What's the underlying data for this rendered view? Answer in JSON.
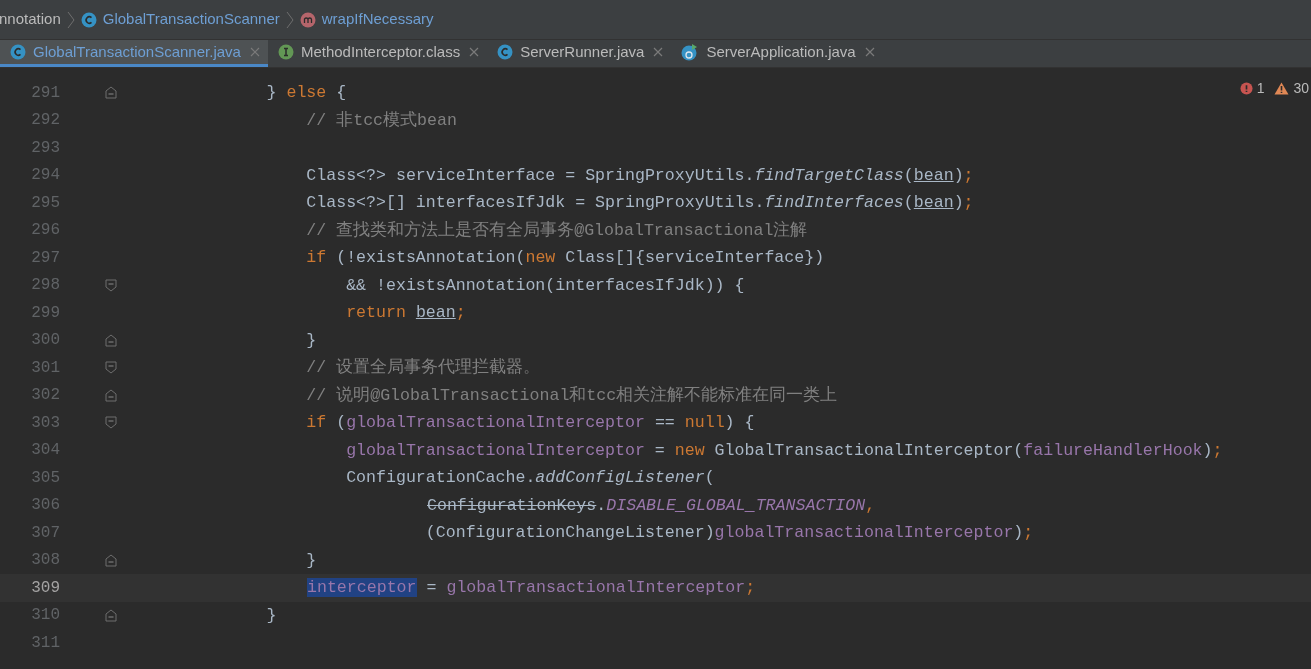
{
  "breadcrumbs": [
    {
      "kind": "none",
      "label": "nnotation"
    },
    {
      "kind": "class",
      "label": "GlobalTransactionScanner"
    },
    {
      "kind": "method",
      "label": "wrapIfNecessary"
    }
  ],
  "tabs": [
    {
      "kind": "class",
      "label": "GlobalTransactionScanner.java",
      "selected": true,
      "modified": true
    },
    {
      "kind": "interface",
      "label": "MethodInterceptor.class",
      "selected": false,
      "modified": false
    },
    {
      "kind": "class",
      "label": "ServerRunner.java",
      "selected": false,
      "modified": false
    },
    {
      "kind": "application",
      "label": "ServerApplication.java",
      "selected": false,
      "modified": false
    }
  ],
  "inspections": {
    "errors": "1",
    "warnings": "30"
  },
  "lines": [
    {
      "number": "291",
      "kind": "fold_end",
      "current": false,
      "tokens": [
        {
          "kind": "plain",
          "text": "            } "
        },
        {
          "kind": "keyword",
          "text": "else"
        },
        {
          "kind": "plain",
          "text": " {"
        }
      ]
    },
    {
      "number": "292",
      "kind": "code",
      "current": false,
      "tokens": [
        {
          "kind": "comment",
          "text": "                // 非tcc模式bean"
        }
      ]
    },
    {
      "number": "293",
      "kind": "code",
      "current": false
    },
    {
      "number": "294",
      "kind": "code",
      "current": false,
      "tokens": [
        {
          "kind": "plain",
          "text": "                Class<?> serviceInterface = SpringProxyUtils."
        },
        {
          "kind": "static",
          "text": "findTargetClass"
        },
        {
          "kind": "plain",
          "text": "("
        },
        {
          "kind": "underline",
          "text": "bean"
        },
        {
          "kind": "plain",
          "text": ")"
        },
        {
          "kind": "keyword",
          "text": ";"
        }
      ]
    },
    {
      "number": "295",
      "kind": "code",
      "current": false,
      "tokens": [
        {
          "kind": "plain",
          "text": "                Class<?>[] interfacesIfJdk = SpringProxyUtils."
        },
        {
          "kind": "static",
          "text": "findInterfaces"
        },
        {
          "kind": "plain",
          "text": "("
        },
        {
          "kind": "underline",
          "text": "bean"
        },
        {
          "kind": "plain",
          "text": ")"
        },
        {
          "kind": "keyword",
          "text": ";"
        }
      ]
    },
    {
      "number": "296",
      "kind": "code",
      "current": false,
      "tokens": [
        {
          "kind": "comment",
          "text": "                // 查找类和方法上是否有全局事务@GlobalTransactional注解"
        }
      ]
    },
    {
      "number": "297",
      "kind": "code",
      "current": false,
      "tokens": [
        {
          "kind": "keyword",
          "text": "                if"
        },
        {
          "kind": "plain",
          "text": " (!existsAnnotation("
        },
        {
          "kind": "keyword",
          "text": "new"
        },
        {
          "kind": "plain",
          "text": " Class[]{serviceInterface})"
        }
      ]
    },
    {
      "number": "298",
      "kind": "fold_start",
      "current": false,
      "tokens": [
        {
          "kind": "plain",
          "text": "                    && !existsAnnotation(interfacesIfJdk)) {"
        }
      ]
    },
    {
      "number": "299",
      "kind": "code",
      "current": false,
      "tokens": [
        {
          "kind": "keyword",
          "text": "                    return "
        },
        {
          "kind": "underline",
          "text": "bean"
        },
        {
          "kind": "keyword",
          "text": ";"
        }
      ]
    },
    {
      "number": "300",
      "kind": "fold_end",
      "current": false,
      "tokens": [
        {
          "kind": "plain",
          "text": "                }"
        }
      ]
    },
    {
      "number": "301",
      "kind": "fold_start",
      "current": false,
      "tokens": [
        {
          "kind": "comment",
          "text": "                // 设置全局事务代理拦截器。"
        }
      ]
    },
    {
      "number": "302",
      "kind": "fold_end",
      "current": false,
      "tokens": [
        {
          "kind": "comment",
          "text": "                // 说明@GlobalTransactional和tcc相关注解不能标准在同一类上"
        }
      ]
    },
    {
      "number": "303",
      "kind": "fold_start",
      "current": false,
      "tokens": [
        {
          "kind": "keyword",
          "text": "                if"
        },
        {
          "kind": "plain",
          "text": " ("
        },
        {
          "kind": "field",
          "text": "globalTransactionalInterceptor"
        },
        {
          "kind": "plain",
          "text": " == "
        },
        {
          "kind": "keyword",
          "text": "null"
        },
        {
          "kind": "plain",
          "text": ") {"
        }
      ]
    },
    {
      "number": "304",
      "kind": "code",
      "current": false,
      "tokens": [
        {
          "kind": "field",
          "text": "                    globalTransactionalInterceptor"
        },
        {
          "kind": "plain",
          "text": " = "
        },
        {
          "kind": "keyword",
          "text": "new"
        },
        {
          "kind": "plain",
          "text": " GlobalTransactionalInterceptor("
        },
        {
          "kind": "field",
          "text": "failureHandlerHook"
        },
        {
          "kind": "plain",
          "text": ")"
        },
        {
          "kind": "keyword",
          "text": ";"
        }
      ]
    },
    {
      "number": "305",
      "kind": "code",
      "current": false,
      "tokens": [
        {
          "kind": "plain",
          "text": "                    ConfigurationCache."
        },
        {
          "kind": "static",
          "text": "addConfigListener"
        },
        {
          "kind": "plain",
          "text": "("
        }
      ]
    },
    {
      "number": "306",
      "kind": "code",
      "current": false,
      "tokens": [
        {
          "kind": "deprecated",
          "text": "ConfigurationKeys"
        },
        {
          "kind": "plain",
          "text": "."
        },
        {
          "kind": "constant",
          "text": "DISABLE_GLOBAL_TRANSACTION"
        },
        {
          "kind": "keyword",
          "text": ","
        }
      ]
    },
    {
      "number": "307",
      "kind": "code",
      "current": false,
      "tokens": [
        {
          "kind": "plain",
          "text": "                            (ConfigurationChangeListener)"
        },
        {
          "kind": "field",
          "text": "globalTransactionalInterceptor"
        },
        {
          "kind": "plain",
          "text": ")"
        },
        {
          "kind": "keyword",
          "text": ";"
        }
      ]
    },
    {
      "number": "308",
      "kind": "fold_end",
      "current": false,
      "tokens": [
        {
          "kind": "plain",
          "text": "                }"
        }
      ]
    },
    {
      "number": "309",
      "kind": "code",
      "current": true,
      "tokens": [
        {
          "kind": "selected",
          "text": "interceptor"
        },
        {
          "kind": "plain",
          "text": " = "
        },
        {
          "kind": "field",
          "text": "globalTransactionalInterceptor"
        },
        {
          "kind": "keyword",
          "text": ";"
        }
      ]
    },
    {
      "number": "310",
      "kind": "fold_end",
      "current": false,
      "tokens": [
        {
          "kind": "plain",
          "text": "            }"
        }
      ]
    },
    {
      "number": "311",
      "kind": "code",
      "current": false
    }
  ]
}
